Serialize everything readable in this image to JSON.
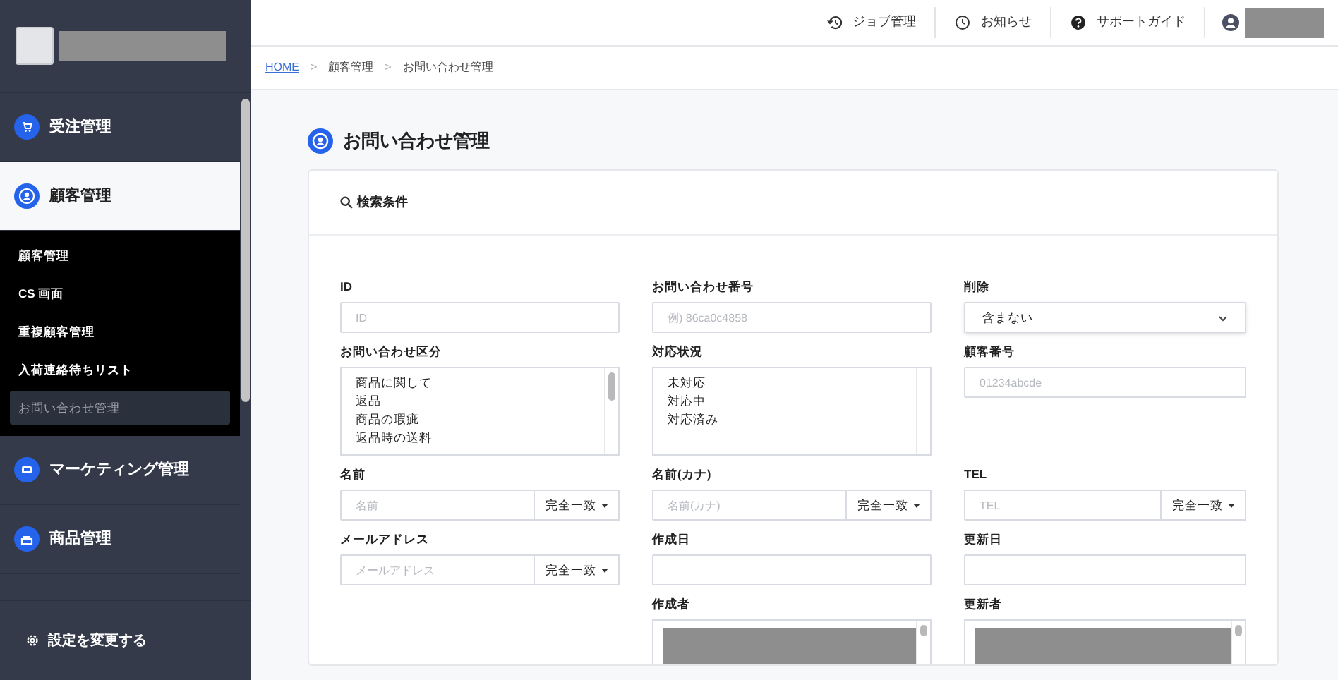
{
  "header": {
    "links": [
      {
        "kind": "history",
        "label": "ジョブ管理"
      },
      {
        "kind": "clock",
        "label": "お知らせ"
      },
      {
        "kind": "help",
        "label": "サポートガイド"
      }
    ]
  },
  "breadcrumb": {
    "separator": ">",
    "items": [
      {
        "label": "HOME",
        "link": true
      },
      {
        "label": "顧客管理",
        "link": false
      },
      {
        "label": "お問い合わせ管理",
        "link": false
      }
    ]
  },
  "sidebar": {
    "items": [
      {
        "label": "受注管理",
        "kind": "cart",
        "expanded": false
      },
      {
        "label": "顧客管理",
        "kind": "person",
        "expanded": true,
        "children": [
          {
            "label": "顧客管理",
            "selected": false
          },
          {
            "label": "CS 画面",
            "selected": false
          },
          {
            "label": "重複顧客管理",
            "selected": false
          },
          {
            "label": "入荷連絡待ちリスト",
            "selected": false
          },
          {
            "label": "お問い合わせ管理",
            "selected": true
          }
        ]
      },
      {
        "label": "マーケティング管理",
        "kind": "screen",
        "expanded": false
      },
      {
        "label": "商品管理",
        "kind": "box",
        "expanded": false
      }
    ],
    "footer": "設定を変更する"
  },
  "page": {
    "title": "お問い合わせ管理"
  },
  "search": {
    "title": "検索条件",
    "columns": [
      [
        {
          "kind": "text",
          "label": "ID",
          "placeholder": "ID"
        },
        {
          "kind": "listbox",
          "label": "お問い合わせ区分",
          "options": [
            "商品に関して",
            "返品",
            "商品の瑕疵",
            "返品時の送料"
          ],
          "scrollable": true
        },
        {
          "kind": "match",
          "label": "名前",
          "placeholder": "名前",
          "match": "完全一致"
        },
        {
          "kind": "match",
          "label": "メールアドレス",
          "placeholder": "メールアドレス",
          "match": "完全一致"
        }
      ],
      [
        {
          "kind": "text",
          "label": "お問い合わせ番号",
          "placeholder": "例) 86ca0c4858"
        },
        {
          "kind": "listbox",
          "label": "対応状況",
          "options": [
            "未対応",
            "対応中",
            "対応済み"
          ],
          "scrollable": false
        },
        {
          "kind": "match",
          "label": "名前(カナ)",
          "placeholder": "名前(カナ)",
          "match": "完全一致"
        },
        {
          "kind": "text",
          "label": "作成日"
        },
        {
          "kind": "users",
          "label": "作成者"
        }
      ],
      [
        {
          "kind": "select",
          "label": "削除",
          "value": "含まない"
        },
        {
          "kind": "text",
          "label": "顧客番号",
          "placeholder": "01234abcde"
        },
        {
          "kind": "match",
          "label": "TEL",
          "placeholder": "TEL",
          "match": "完全一致"
        },
        {
          "kind": "text",
          "label": "更新日"
        },
        {
          "kind": "users",
          "label": "更新者"
        }
      ]
    ]
  }
}
